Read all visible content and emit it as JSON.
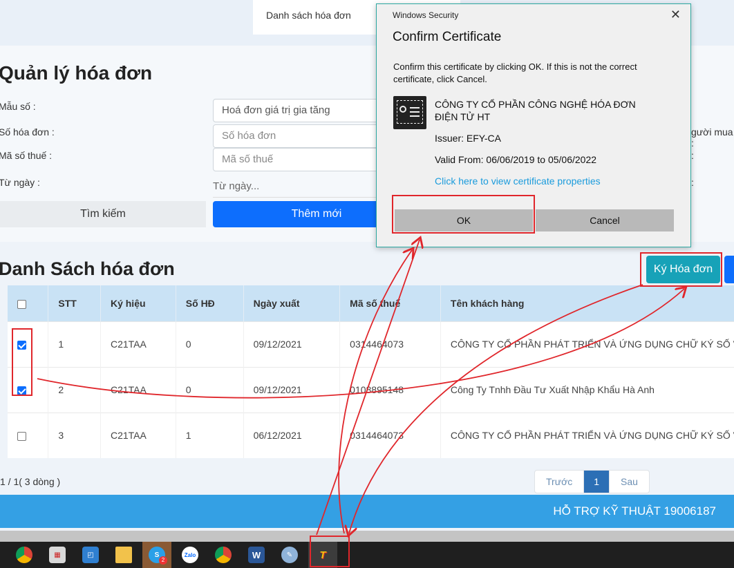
{
  "header": {
    "tab_label": "Danh sách hóa đơn"
  },
  "search": {
    "title": "Quản lý hóa đơn",
    "template_label": "Mẫu số :",
    "template_value": "Hoá đơn giá trị gia tăng",
    "invoice_no_label": "Số hóa đơn :",
    "invoice_no_placeholder": "Số hóa đơn",
    "tax_code_label": "Mã số thuế :",
    "tax_code_placeholder": "Mã số thuế",
    "from_date_label": "Từ ngày :",
    "from_date_placeholder": "Từ ngày...",
    "buyer_label_fragment": "gười mua :",
    "colon_1": ":",
    "colon_2": ":",
    "search_button": "Tìm kiếm",
    "add_button": "Thêm mới"
  },
  "list": {
    "title": "Danh Sách hóa đơn",
    "sign_button": "Ký Hóa đơn",
    "columns": [
      "STT",
      "Ký hiệu",
      "Số HĐ",
      "Ngày xuất",
      "Mã số thuế",
      "Tên khách hàng"
    ],
    "rows": [
      {
        "checked": true,
        "stt": "1",
        "symbol": "C21TAA",
        "number": "0",
        "date": "09/12/2021",
        "tax": "0314464073",
        "customer": "CÔNG TY CỔ PHẦN PHÁT TRIỂN VÀ ỨNG DỤNG CHỮ KÝ SỐ V"
      },
      {
        "checked": true,
        "stt": "2",
        "symbol": "C21TAA",
        "number": "0",
        "date": "09/12/2021",
        "tax": "0108895148",
        "customer": "Công Ty Tnhh Đầu Tư Xuất Nhập Khẩu Hà Anh"
      },
      {
        "checked": false,
        "stt": "3",
        "symbol": "C21TAA",
        "number": "1",
        "date": "06/12/2021",
        "tax": "0314464073",
        "customer": "CÔNG TY CỔ PHẦN PHÁT TRIỂN VÀ ỨNG DỤNG CHỮ KÝ SỐ V"
      }
    ],
    "page_info": "1 / 1( 3 dòng )",
    "pager": {
      "prev": "Trước",
      "current": "1",
      "next": "Sau"
    }
  },
  "footer": {
    "support": "HỖ TRỢ KỸ THUẬT 19006187"
  },
  "dialog": {
    "caption": "Windows Security",
    "close": "✕",
    "title": "Confirm Certificate",
    "message": "Confirm this certificate by clicking OK. If this is not the correct certificate, click Cancel.",
    "cert_name": "CÔNG TY CỔ PHẦN CÔNG NGHỆ HÓA ĐƠN ĐIỆN TỬ HT",
    "issuer": "Issuer: EFY-CA",
    "valid": "Valid From: 06/06/2019 to 05/06/2022",
    "link": "Click here to view certificate properties",
    "ok": "OK",
    "cancel": "Cancel"
  },
  "taskbar": {
    "items": [
      {
        "icon": "chrome-icon",
        "color": "#4285f4"
      },
      {
        "icon": "app-grid-icon",
        "color": "#d9d9d9"
      },
      {
        "icon": "remote-desktop-icon",
        "color": "#2f7fd0"
      },
      {
        "icon": "folder-icon",
        "color": "#f2c24b"
      },
      {
        "icon": "skype-icon",
        "color": "#2aa0e8",
        "badge": "2"
      },
      {
        "icon": "zalo-icon",
        "color": "#ffffff",
        "text": "Zalo"
      },
      {
        "icon": "chrome-profile-icon",
        "color": "#4285f4"
      },
      {
        "icon": "word-icon",
        "color": "#2b5797",
        "text": "W"
      },
      {
        "icon": "paint-icon",
        "color": "#8fb3d9"
      },
      {
        "icon": "signing-tool-icon",
        "color": "#d62828",
        "text": "T"
      }
    ]
  },
  "colors": {
    "accent": "#0d6efd",
    "sign": "#17a2b8",
    "footer": "#34a0e4",
    "annotation": "#e0262b"
  }
}
